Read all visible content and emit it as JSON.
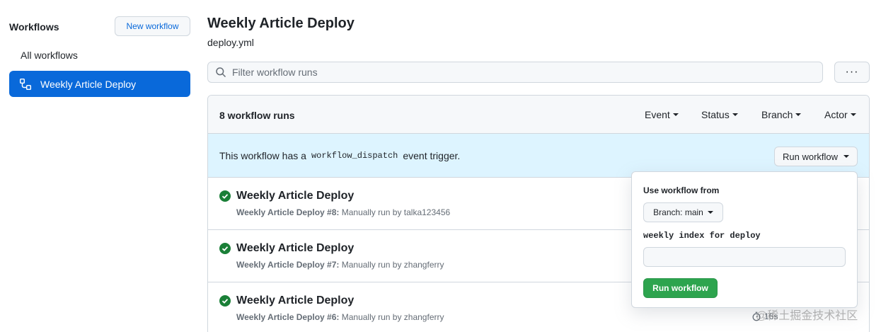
{
  "sidebar": {
    "title": "Workflows",
    "new_workflow_label": "New workflow",
    "items": [
      {
        "label": "All workflows",
        "active": false
      },
      {
        "label": "Weekly Article Deploy",
        "active": true
      }
    ],
    "accent_color": "#0969da"
  },
  "header": {
    "title": "Weekly Article Deploy",
    "file": "deploy.yml"
  },
  "filter": {
    "placeholder": "Filter workflow runs",
    "value": "",
    "more_label": "···"
  },
  "runs": {
    "count_label": "8 workflow runs",
    "filters": [
      "Event",
      "Status",
      "Branch",
      "Actor"
    ],
    "dispatch": {
      "prefix": "This workflow has a",
      "code": "workflow_dispatch",
      "suffix": "event trigger.",
      "button_label": "Run workflow"
    },
    "items": [
      {
        "title": "Weekly Article Deploy",
        "meta_bold": "Weekly Article Deploy #8:",
        "meta_rest": " Manually run by talka123456",
        "status": "success"
      },
      {
        "title": "Weekly Article Deploy",
        "meta_bold": "Weekly Article Deploy #7:",
        "meta_rest": " Manually run by zhangferry",
        "status": "success"
      },
      {
        "title": "Weekly Article Deploy",
        "meta_bold": "Weekly Article Deploy #6:",
        "meta_rest": " Manually run by zhangferry",
        "status": "success"
      }
    ],
    "duration_label": "16s"
  },
  "popover": {
    "title": "Use workflow from",
    "branch_label": "Branch: main",
    "input_label": "weekly index for deploy",
    "input_value": "",
    "submit_label": "Run workflow",
    "submit_color": "#2da44e"
  },
  "watermark": "@稀土掘金技术社区",
  "colors": {
    "dispatch_bg": "#ddf4ff",
    "success": "#1a7f37",
    "border": "#d0d7de"
  }
}
